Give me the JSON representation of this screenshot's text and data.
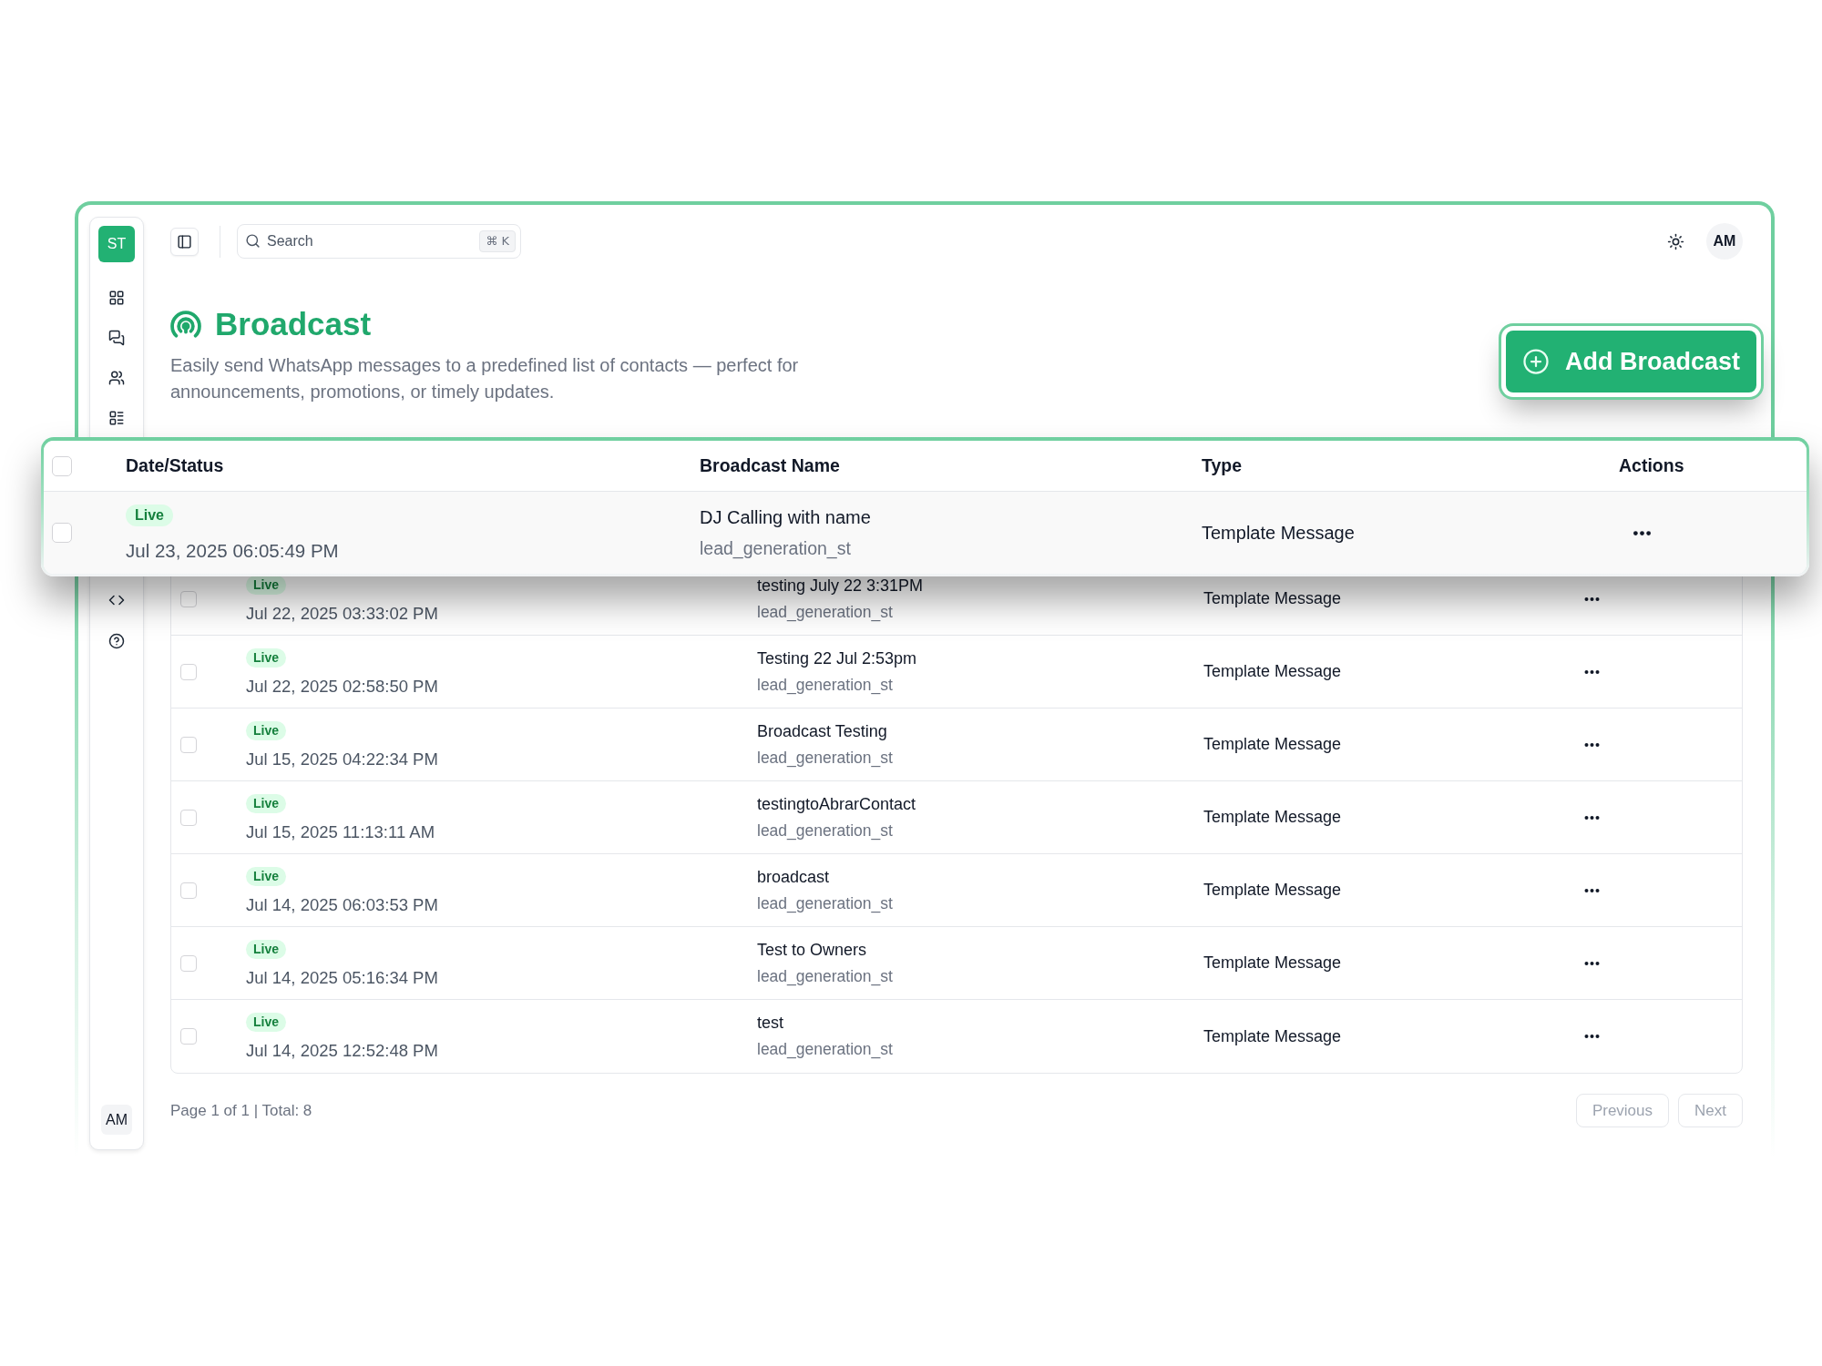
{
  "sidebar": {
    "logo": "ST",
    "user_initials": "AM"
  },
  "topbar": {
    "search": {
      "placeholder": "Search",
      "shortcut": "⌘ K"
    },
    "avatar": "AM"
  },
  "header": {
    "title": "Broadcast",
    "description": "Easily send WhatsApp messages to a predefined list of contacts — perfect for announcements, promotions, or timely updates.",
    "add_button": "Add Broadcast"
  },
  "highlight": {
    "columns": [
      "Date/Status",
      "Broadcast Name",
      "Type",
      "Actions"
    ],
    "header_checked": false,
    "row": {
      "status": "Live",
      "date": "Jul 23, 2025 06:05:49 PM",
      "name": "DJ Calling with name",
      "template": "lead_generation_st",
      "type": "Template Message",
      "checked": false
    }
  },
  "table": {
    "rows": [
      {
        "status": "Live",
        "date": "Jul 22, 2025 03:33:02 PM",
        "name": "testing July 22 3:31PM",
        "template": "lead_generation_st",
        "type": "Template Message",
        "checked": false
      },
      {
        "status": "Live",
        "date": "Jul 22, 2025 02:58:50 PM",
        "name": "Testing 22 Jul 2:53pm",
        "template": "lead_generation_st",
        "type": "Template Message",
        "checked": false
      },
      {
        "status": "Live",
        "date": "Jul 15, 2025 04:22:34 PM",
        "name": "Broadcast Testing",
        "template": "lead_generation_st",
        "type": "Template Message",
        "checked": false
      },
      {
        "status": "Live",
        "date": "Jul 15, 2025 11:13:11 AM",
        "name": "testingtoAbrarContact",
        "template": "lead_generation_st",
        "type": "Template Message",
        "checked": false
      },
      {
        "status": "Live",
        "date": "Jul 14, 2025 06:03:53 PM",
        "name": "broadcast",
        "template": "lead_generation_st",
        "type": "Template Message",
        "checked": false
      },
      {
        "status": "Live",
        "date": "Jul 14, 2025 05:16:34 PM",
        "name": "Test to Owners",
        "template": "lead_generation_st",
        "type": "Template Message",
        "checked": false
      },
      {
        "status": "Live",
        "date": "Jul 14, 2025 12:52:48 PM",
        "name": "test",
        "template": "lead_generation_st",
        "type": "Template Message",
        "checked": false
      }
    ]
  },
  "pagination": {
    "summary": "Page 1 of 1 | Total: 8",
    "buttons": [
      {
        "label": "Previous",
        "disabled": true
      },
      {
        "label": "Next",
        "disabled": true
      }
    ]
  }
}
